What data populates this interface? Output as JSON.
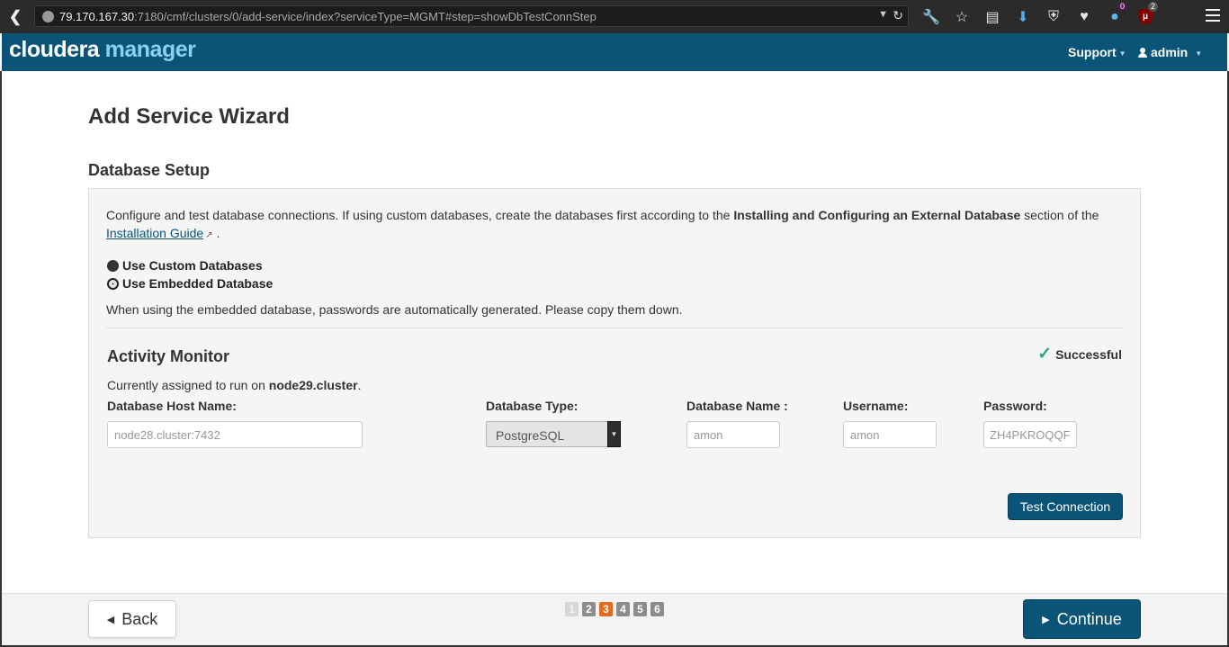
{
  "browser": {
    "url_host": "79.170.167.30",
    "url_rest": ":7180/cmf/clusters/0/add-service/index?serviceType=MGMT#step=showDbTestConnStep",
    "toolbar_icons": [
      "wrench-icon",
      "star-icon",
      "reader-icon",
      "download-icon",
      "shield-icon",
      "pocket-icon",
      "ghostery-icon",
      "ublock-icon"
    ],
    "ghostery_badge": "0",
    "ublock_badge": "2"
  },
  "header": {
    "logo_primary": "cloudera",
    "logo_secondary": "manager",
    "support_label": "Support",
    "user_label": "admin",
    "color": "#0a5478"
  },
  "page": {
    "title": "Add Service Wizard",
    "section_title": "Database Setup"
  },
  "intro": {
    "text_before": "Configure and test database connections. If using custom databases, create the databases first according to the ",
    "bold_text": "Installing and Configuring an External Database",
    "text_middle": " section of the ",
    "link_text": "Installation Guide",
    "text_after": " ."
  },
  "options": {
    "custom_label": "Use Custom Databases",
    "embedded_label": "Use Embedded Database",
    "selected": "embedded"
  },
  "embedded_note": "When using the embedded database, passwords are automatically generated. Please copy them down.",
  "activity_monitor": {
    "title": "Activity Monitor",
    "status": "Successful",
    "assigned_prefix": "Currently assigned to run on ",
    "assigned_host": "node29.cluster",
    "assigned_suffix": ".",
    "fields": {
      "host_label": "Database Host Name:",
      "host_value": "node28.cluster:7432",
      "type_label": "Database Type:",
      "type_value": "PostgreSQL",
      "name_label": "Database Name :",
      "name_value": "amon",
      "user_label": "Username:",
      "user_value": "amon",
      "password_label": "Password:",
      "password_value": "ZH4PKROQQF"
    },
    "test_button": "Test Connection"
  },
  "footer": {
    "back_label": "Back",
    "continue_label": "Continue",
    "steps": [
      "1",
      "2",
      "3",
      "4",
      "5",
      "6"
    ],
    "current_step": "3"
  }
}
